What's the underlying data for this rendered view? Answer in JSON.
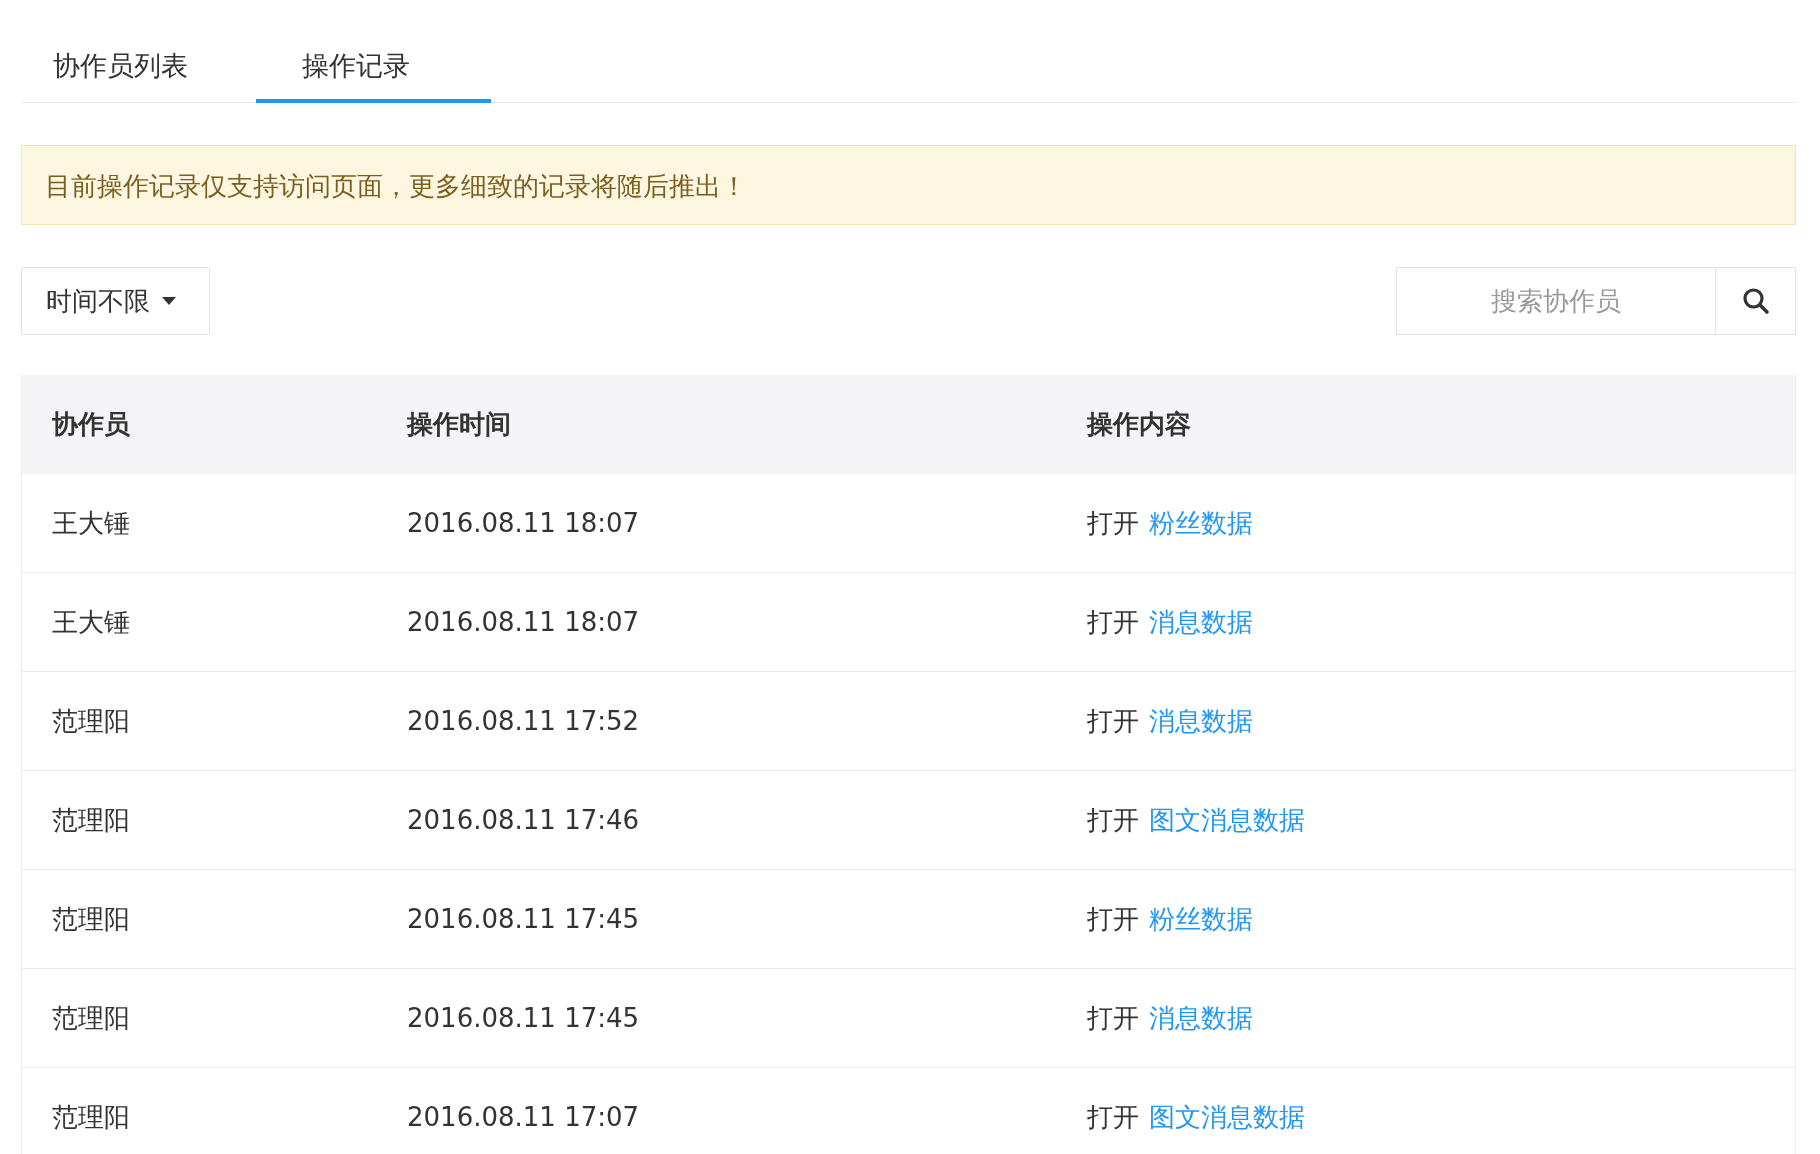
{
  "tabs": [
    {
      "label": "协作员列表",
      "selected": false
    },
    {
      "label": "操作记录",
      "selected": true
    }
  ],
  "notice": "目前操作记录仅支持访问页面，更多细致的记录将随后推出！",
  "time_filter": {
    "label": "时间不限"
  },
  "search": {
    "placeholder": "搜索协作员"
  },
  "table": {
    "columns": [
      "协作员",
      "操作时间",
      "操作内容"
    ],
    "rows": [
      {
        "user": "王大锤",
        "time": "2016.08.11 18:07",
        "action": "打开",
        "target": "粉丝数据"
      },
      {
        "user": "王大锤",
        "time": "2016.08.11 18:07",
        "action": "打开",
        "target": "消息数据"
      },
      {
        "user": "范理阳",
        "time": "2016.08.11 17:52",
        "action": "打开",
        "target": "消息数据"
      },
      {
        "user": "范理阳",
        "time": "2016.08.11 17:46",
        "action": "打开",
        "target": "图文消息数据"
      },
      {
        "user": "范理阳",
        "time": "2016.08.11 17:45",
        "action": "打开",
        "target": "粉丝数据"
      },
      {
        "user": "范理阳",
        "time": "2016.08.11 17:45",
        "action": "打开",
        "target": "消息数据"
      },
      {
        "user": "范理阳",
        "time": "2016.08.11 17:07",
        "action": "打开",
        "target": "图文消息数据"
      }
    ]
  }
}
